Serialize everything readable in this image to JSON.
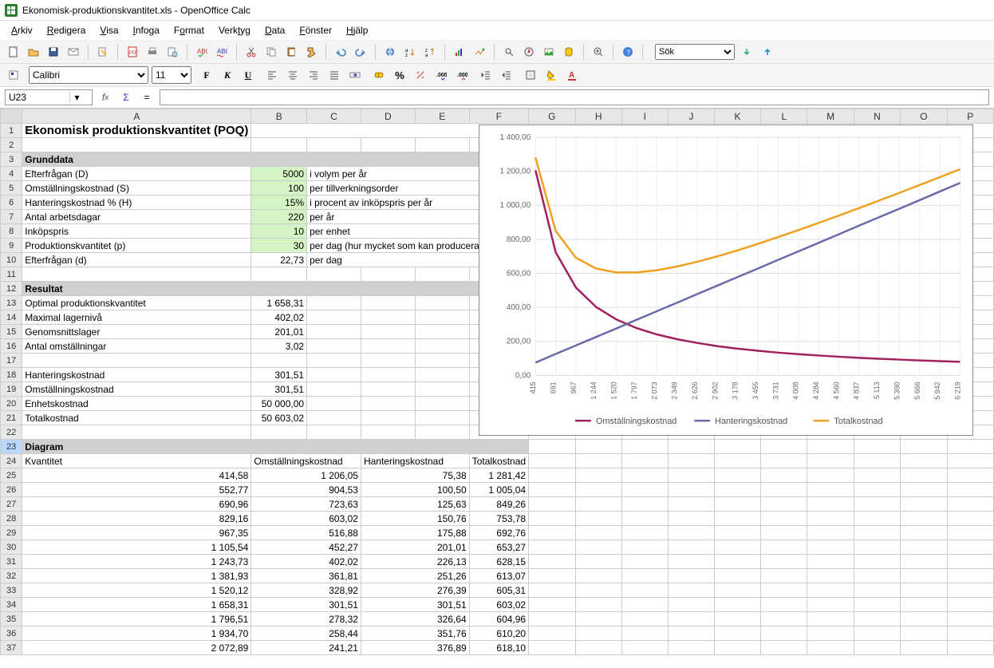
{
  "window": {
    "title": "Ekonomisk-produktionskvantitet.xls - OpenOffice Calc"
  },
  "menu": {
    "items": [
      "Arkiv",
      "Redigera",
      "Visa",
      "Infoga",
      "Format",
      "Verktyg",
      "Data",
      "Fönster",
      "Hjälp"
    ]
  },
  "search": {
    "placeholder": "Sök"
  },
  "format": {
    "font": "Calibri",
    "size": "11"
  },
  "cellref": {
    "name": "U23",
    "formula": ""
  },
  "columns": [
    "A",
    "B",
    "C",
    "D",
    "E",
    "F",
    "G",
    "H",
    "I",
    "J",
    "K",
    "L",
    "M",
    "N",
    "O",
    "P"
  ],
  "sheet": {
    "title": "Ekonomisk produktionskvantitet (POQ)",
    "section_grunddata": "Grunddata",
    "grunddata": [
      {
        "label": "Efterfrågan (D)",
        "val": "5000",
        "unit": "i volym per år"
      },
      {
        "label": "Omställningskostnad (S)",
        "val": "100",
        "unit": "per tillverkningsorder"
      },
      {
        "label": "Hanteringskostnad % (H)",
        "val": "15%",
        "unit": "i procent av inköpspris per år"
      },
      {
        "label": "Antal arbetsdagar",
        "val": "220",
        "unit": "per år"
      },
      {
        "label": "Inköpspris",
        "val": "10",
        "unit": "per enhet"
      },
      {
        "label": "Produktionskvantitet (p)",
        "val": "30",
        "unit": "per dag (hur mycket som kan produceras per dag)"
      },
      {
        "label": "Efterfrågan (d)",
        "val": "22,73",
        "unit": "per dag"
      }
    ],
    "section_resultat": "Resultat",
    "resultat": [
      {
        "label": "Optimal produktionskvantitet",
        "val": "1 658,31"
      },
      {
        "label": "Maximal lagernivå",
        "val": "402,02"
      },
      {
        "label": "Genomsnittslager",
        "val": "201,01"
      },
      {
        "label": "Antal omställningar",
        "val": "3,02"
      }
    ],
    "resultat2": [
      {
        "label": "Hanteringskostnad",
        "val": "301,51"
      },
      {
        "label": "Omställningskostnad",
        "val": "301,51"
      },
      {
        "label": "Enhetskostnad",
        "val": "50 000,00"
      },
      {
        "label": "Totalkostnad",
        "val": "50 603,02"
      }
    ],
    "section_diagram": "Diagram",
    "diagram_headers": [
      "Kvantitet",
      "Omställningskostnad",
      "Hanteringskostnad",
      "Totalkostnad"
    ],
    "diagram_rows": [
      [
        "414,58",
        "1 206,05",
        "75,38",
        "1 281,42"
      ],
      [
        "552,77",
        "904,53",
        "100,50",
        "1 005,04"
      ],
      [
        "690,96",
        "723,63",
        "125,63",
        "849,26"
      ],
      [
        "829,16",
        "603,02",
        "150,76",
        "753,78"
      ],
      [
        "967,35",
        "516,88",
        "175,88",
        "692,76"
      ],
      [
        "1 105,54",
        "452,27",
        "201,01",
        "653,27"
      ],
      [
        "1 243,73",
        "402,02",
        "226,13",
        "628,15"
      ],
      [
        "1 381,93",
        "361,81",
        "251,26",
        "613,07"
      ],
      [
        "1 520,12",
        "328,92",
        "276,39",
        "605,31"
      ],
      [
        "1 658,31",
        "301,51",
        "301,51",
        "603,02"
      ],
      [
        "1 796,51",
        "278,32",
        "326,64",
        "604,96"
      ],
      [
        "1 934,70",
        "258,44",
        "351,76",
        "610,20"
      ],
      [
        "2 072,89",
        "241,21",
        "376,89",
        "618,10"
      ]
    ]
  },
  "chart_data": {
    "type": "line",
    "x": [
      415,
      691,
      967,
      1244,
      1520,
      1797,
      2073,
      2349,
      2626,
      2902,
      3178,
      3455,
      3731,
      4008,
      4284,
      4560,
      4837,
      5113,
      5390,
      5666,
      5942,
      6219
    ],
    "series": [
      {
        "name": "Omställningskostnad",
        "color": "#a02060",
        "values": [
          1206,
          724,
          517,
          402,
          329,
          278,
          241,
          213,
          191,
          172,
          157,
          145,
          134,
          125,
          117,
          110,
          103,
          98,
          93,
          88,
          84,
          80
        ]
      },
      {
        "name": "Hanteringskostnad",
        "color": "#6a6aa8",
        "values": [
          75,
          126,
          176,
          226,
          276,
          327,
          377,
          427,
          478,
          528,
          578,
          628,
          679,
          729,
          779,
          829,
          880,
          930,
          980,
          1030,
          1081,
          1131
        ]
      },
      {
        "name": "Totalkostnad",
        "color": "#f0a020",
        "values": [
          1281,
          849,
          692,
          628,
          605,
          605,
          618,
          640,
          668,
          700,
          735,
          773,
          813,
          854,
          896,
          939,
          983,
          1028,
          1073,
          1119,
          1165,
          1212
        ]
      }
    ],
    "ylim": [
      0,
      1400
    ],
    "yticks": [
      "0,00",
      "200,00",
      "400,00",
      "600,00",
      "800,00",
      "1 000,00",
      "1 200,00",
      "1 400,00"
    ],
    "xticks": [
      "415",
      "691",
      "967",
      "1 244",
      "1 520",
      "1 797",
      "2 073",
      "2 349",
      "2 626",
      "2 902",
      "3 178",
      "3 455",
      "3 731",
      "4 008",
      "4 284",
      "4 560",
      "4 837",
      "5 113",
      "5 390",
      "5 666",
      "5 942",
      "6 219"
    ],
    "legend": [
      "Omställningskostnad",
      "Hanteringskostnad",
      "Totalkostnad"
    ]
  }
}
